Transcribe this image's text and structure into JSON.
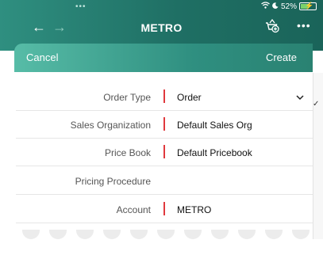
{
  "status_bar": {
    "dots": "•••",
    "battery_text": "52%"
  },
  "nav": {
    "back_icon": "arrow-left-icon",
    "forward_icon": "arrow-right-icon",
    "title": "METRO",
    "cart_icon": "cart-add-icon",
    "more_label": "•••"
  },
  "sheet": {
    "cancel_label": "Cancel",
    "create_label": "Create"
  },
  "form": {
    "rows": [
      {
        "label": "Order Type",
        "value": "Order",
        "required": true,
        "dropdown": true
      },
      {
        "label": "Sales Organization",
        "value": "Default Sales Org",
        "required": true
      },
      {
        "label": "Price Book",
        "value": "Default Pricebook",
        "required": true
      },
      {
        "label": "Pricing Procedure",
        "value": "",
        "required": false
      },
      {
        "label": "Account",
        "value": "METRO",
        "required": true
      }
    ]
  },
  "colors": {
    "header_teal": "#2f8f80",
    "sheet_header_light": "#57bca7",
    "required_red": "#e0393e"
  }
}
